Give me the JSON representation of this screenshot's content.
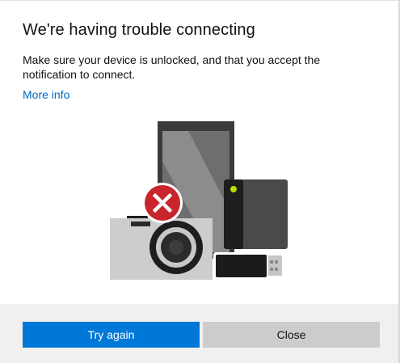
{
  "dialog": {
    "title": "We're having trouble connecting",
    "message": "Make sure your device is unlocked, and that you accept the notification to connect.",
    "more_info_label": "More info"
  },
  "illustration": {
    "devices": [
      "phone-icon",
      "external-drive-icon",
      "usb-stick-icon",
      "camera-icon"
    ],
    "error_badge_icon": "error-x-icon"
  },
  "buttons": {
    "try_again_label": "Try again",
    "close_label": "Close"
  },
  "colors": {
    "accent": "#0078d7",
    "link": "#0067c0",
    "error": "#c9252d",
    "drive_light": "#b6e000"
  }
}
